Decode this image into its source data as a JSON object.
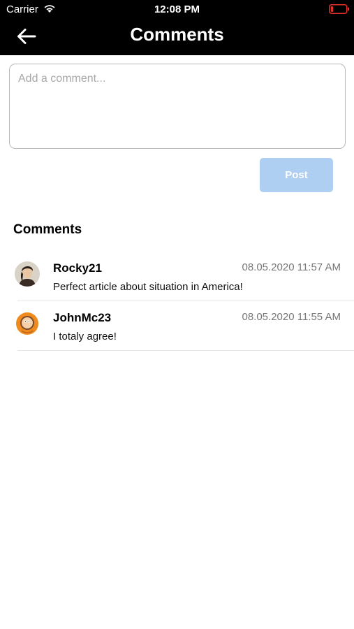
{
  "status_bar": {
    "carrier": "Carrier",
    "time": "12:08 PM",
    "icons": [
      "wifi-icon",
      "battery-icon"
    ],
    "battery_color": "#e0312a"
  },
  "header": {
    "title": "Comments",
    "back_icon": "arrow-left-icon",
    "background": "#000000"
  },
  "composer": {
    "placeholder": "Add a comment...",
    "value": "",
    "post_label": "Post",
    "post_color": "#aecff2"
  },
  "comments_section": {
    "title": "Comments",
    "items": [
      {
        "username": "Rocky21",
        "timestamp": "08.05.2020 11:57 AM",
        "text": "Perfect article about situation in America!",
        "avatar": "avatar-portrait-man"
      },
      {
        "username": "JohnMc23",
        "timestamp": "08.05.2020 11:55 AM",
        "text": "I totaly agree!",
        "avatar": "avatar-orange-hood-cartoon"
      }
    ]
  }
}
